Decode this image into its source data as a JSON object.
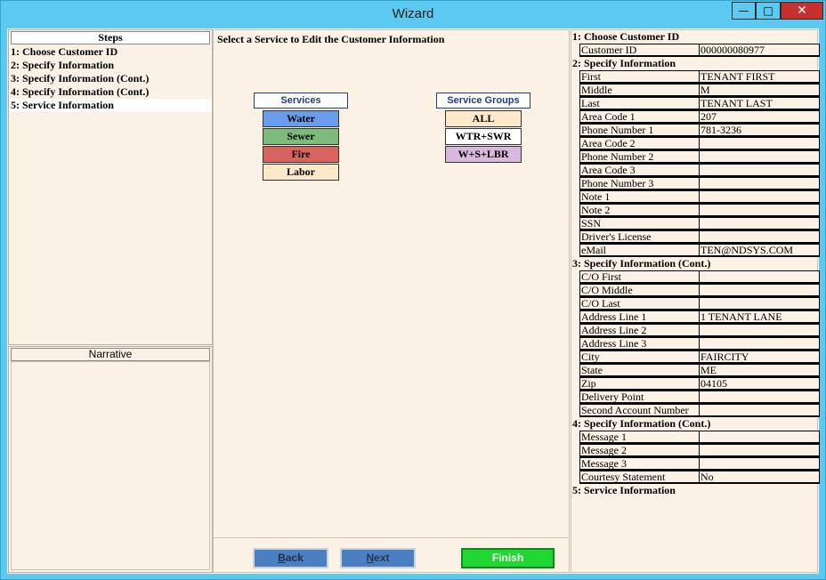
{
  "window": {
    "title": "Wizard"
  },
  "steps": {
    "header": "Steps",
    "items": [
      "1: Choose Customer ID",
      "2: Specify Information",
      "3: Specify Information (Cont.)",
      "4: Specify Information (Cont.)",
      "5: Service Information"
    ]
  },
  "narrative": {
    "header": "Narrative"
  },
  "center": {
    "title": "Select a Service to Edit the Customer Information",
    "services_header": "Services",
    "services": [
      {
        "label": "Water",
        "color": "#6a9cec"
      },
      {
        "label": "Sewer",
        "color": "#7dbb7a"
      },
      {
        "label": "Fire",
        "color": "#d9635e"
      },
      {
        "label": "Labor",
        "color": "#fde8c9"
      }
    ],
    "groups_header": "Service Groups",
    "groups": [
      {
        "label": "ALL",
        "color": "#fde8c9"
      },
      {
        "label": "WTR+SWR",
        "color": "#ffffff"
      },
      {
        "label": "W+S+LBR",
        "color": "#d9b8de"
      }
    ]
  },
  "buttons": {
    "back": "Back",
    "next": "Next",
    "finish": "Finish"
  },
  "summary": {
    "s1": {
      "title": "1: Choose Customer ID",
      "rows": [
        [
          "Customer  ID",
          "000000080977"
        ]
      ]
    },
    "s2": {
      "title": "2: Specify Information",
      "rows": [
        [
          "First",
          "TENANT FIRST"
        ],
        [
          "Middle",
          "M"
        ],
        [
          "Last",
          "TENANT LAST"
        ],
        [
          "Area Code 1",
          "207"
        ],
        [
          "Phone Number 1",
          "781-3236"
        ],
        [
          "Area Code 2",
          ""
        ],
        [
          "Phone Number 2",
          ""
        ],
        [
          "Area Code 3",
          ""
        ],
        [
          "Phone Number 3",
          ""
        ],
        [
          "Note 1",
          ""
        ],
        [
          "Note 2",
          ""
        ],
        [
          "SSN",
          ""
        ],
        [
          "Driver's License",
          ""
        ],
        [
          "eMail",
          "TEN@NDSYS.COM"
        ]
      ]
    },
    "s3": {
      "title": "3: Specify Information (Cont.)",
      "rows": [
        [
          "C/O First",
          ""
        ],
        [
          "C/O Middle",
          ""
        ],
        [
          "C/O Last",
          ""
        ],
        [
          "Address Line 1",
          "1 TENANT LANE"
        ],
        [
          "Address Line 2",
          ""
        ],
        [
          "Address Line 3",
          ""
        ],
        [
          "City",
          "FAIRCITY"
        ],
        [
          "State",
          "ME"
        ],
        [
          "Zip",
          "04105"
        ],
        [
          "Delivery Point",
          ""
        ],
        [
          "Second Account Number",
          ""
        ]
      ]
    },
    "s4": {
      "title": "4: Specify Information (Cont.)",
      "rows": [
        [
          "Message 1",
          ""
        ],
        [
          "Message 2",
          ""
        ],
        [
          "Message 3",
          ""
        ],
        [
          "Courtesy Statement",
          "No"
        ]
      ]
    },
    "s5": {
      "title": "5: Service Information"
    }
  }
}
